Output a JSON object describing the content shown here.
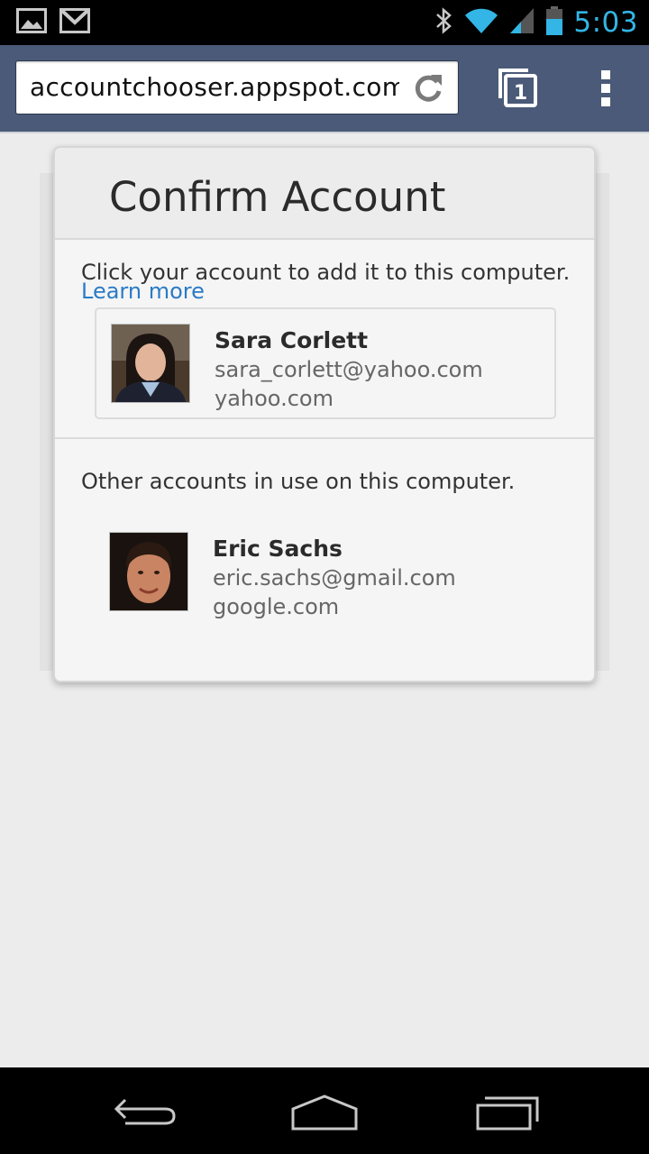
{
  "status_bar": {
    "time": "5:03",
    "icons": [
      "gallery-icon",
      "gmail-icon",
      "bluetooth-icon",
      "wifi-icon",
      "signal-icon",
      "battery-icon"
    ],
    "accent": "#33b5e5"
  },
  "browser": {
    "url": "accountchooser.appspot.com/",
    "tab_count": "1",
    "icons": [
      "reload-icon",
      "tabs-icon",
      "overflow-menu-icon"
    ]
  },
  "dialog": {
    "title": "Confirm Account",
    "instruction": "Click your account to add it to this computer.",
    "learn_more": "Learn more",
    "primary_account": {
      "name": "Sara Corlett",
      "email": "sara_corlett@yahoo.com",
      "domain": "yahoo.com"
    },
    "other_label": "Other accounts in use on this computer.",
    "other_account": {
      "name": "Eric Sachs",
      "email": "eric.sachs@gmail.com",
      "domain": "google.com"
    },
    "link_color": "#2a7bc6"
  },
  "nav_bar": {
    "icons": [
      "back-icon",
      "home-icon",
      "recents-icon"
    ]
  }
}
